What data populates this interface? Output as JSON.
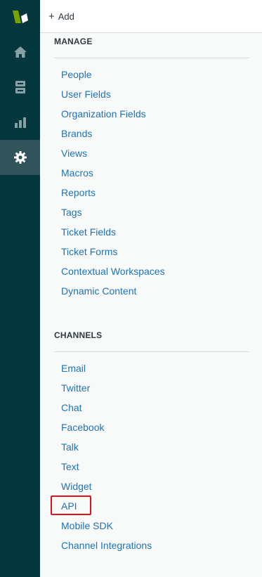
{
  "header": {
    "add_label": "Add",
    "plus_glyph": "+"
  },
  "rail": {
    "logo_icon": "zendesk-logo",
    "items": [
      {
        "icon": "home-icon"
      },
      {
        "icon": "views-icon"
      },
      {
        "icon": "reporting-icon"
      },
      {
        "icon": "gear-icon",
        "active": true
      }
    ]
  },
  "sections": {
    "manage": {
      "title": "MANAGE",
      "items": [
        "People",
        "User Fields",
        "Organization Fields",
        "Brands",
        "Views",
        "Macros",
        "Reports",
        "Tags",
        "Ticket Fields",
        "Ticket Forms",
        "Contextual Workspaces",
        "Dynamic Content"
      ]
    },
    "channels": {
      "title": "CHANNELS",
      "items": [
        "Email",
        "Twitter",
        "Chat",
        "Facebook",
        "Talk",
        "Text",
        "Widget",
        "API",
        "Mobile SDK",
        "Channel Integrations"
      ]
    }
  },
  "colors": {
    "rail": "#03363d",
    "rail_active": "#30545a",
    "link": "#1f73b7",
    "highlight": "#e3121e",
    "logo_green": "#78a300"
  }
}
